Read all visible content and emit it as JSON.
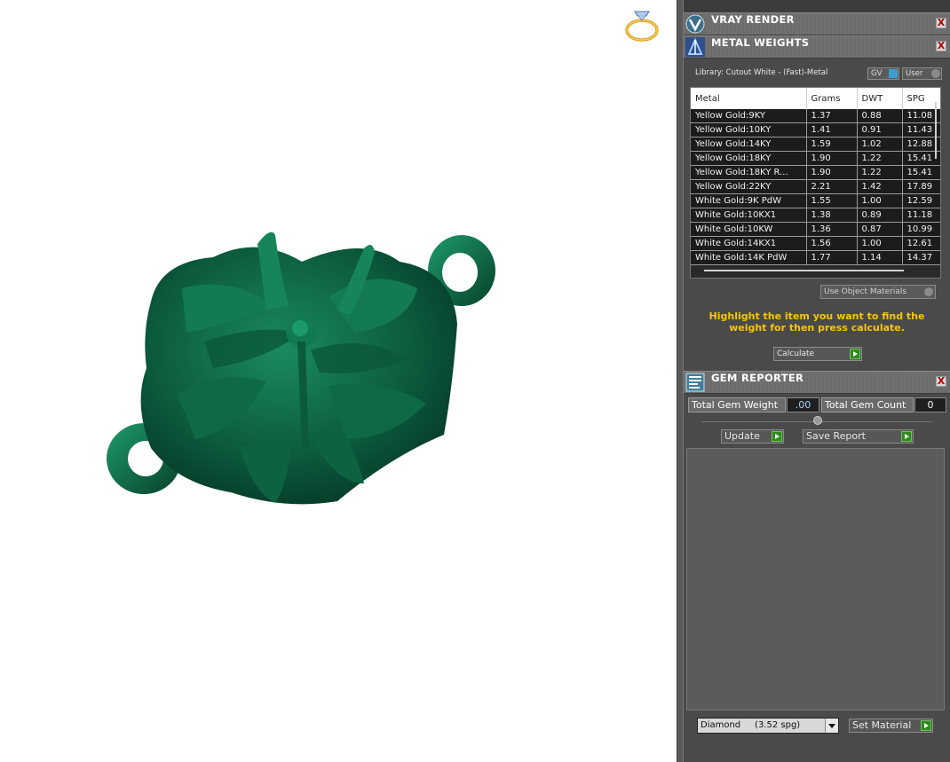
{
  "sections": {
    "vray": {
      "title": "VRAY RENDER",
      "close": "X"
    },
    "metal": {
      "title": "METAL WEIGHTS",
      "close": "X"
    },
    "gem": {
      "title": "GEM REPORTER",
      "close": "X"
    }
  },
  "metal_weights": {
    "library_label": "Library: Cutout White - (Fast)-Metal",
    "toggle_gv": "GV",
    "toggle_user": "User",
    "columns": [
      "Metal",
      "Grams",
      "DWT",
      "SPG"
    ],
    "rows": [
      [
        "Yellow Gold:9KY",
        "1.37",
        "0.88",
        "11.08"
      ],
      [
        "Yellow Gold:10KY",
        "1.41",
        "0.91",
        "11.43"
      ],
      [
        "Yellow Gold:14KY",
        "1.59",
        "1.02",
        "12.88"
      ],
      [
        "Yellow Gold:18KY",
        "1.90",
        "1.22",
        "15.41"
      ],
      [
        "Yellow Gold:18KY R...",
        "1.90",
        "1.22",
        "15.41"
      ],
      [
        "Yellow Gold:22KY",
        "2.21",
        "1.42",
        "17.89"
      ],
      [
        "White Gold:9K PdW",
        "1.55",
        "1.00",
        "12.59"
      ],
      [
        "White Gold:10KX1",
        "1.38",
        "0.89",
        "11.18"
      ],
      [
        "White Gold:10KW",
        "1.36",
        "0.87",
        "10.99"
      ],
      [
        "White Gold:14KX1",
        "1.56",
        "1.00",
        "12.61"
      ],
      [
        "White Gold:14K PdW",
        "1.77",
        "1.14",
        "14.37"
      ]
    ],
    "use_object_materials": "Use Object Materials",
    "hint": "Highlight the item you want to find the weight for then press calculate.",
    "calculate": "Calculate"
  },
  "gem_reporter": {
    "total_weight_label": "Total Gem Weight",
    "total_weight_value": ".00",
    "total_count_label": "Total Gem Count",
    "total_count_value": "0",
    "update": "Update",
    "save_report": "Save Report",
    "material_select": "Diamond     (3.52 spg)",
    "set_material": "Set Material"
  },
  "colors": {
    "model_green": "#0b5a3c",
    "hint_yellow": "#f7c600",
    "go_green": "#2f8a1e"
  }
}
